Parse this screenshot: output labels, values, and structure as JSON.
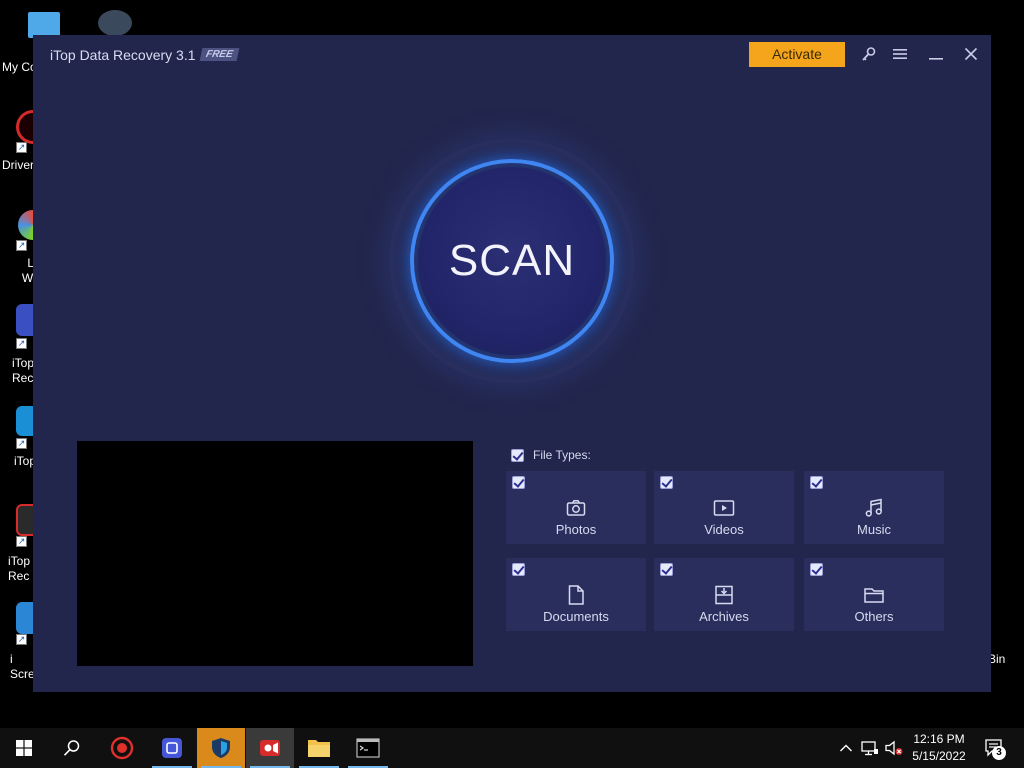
{
  "desktop": {
    "icons": [
      {
        "label": "My Co"
      },
      {
        "label": "Driver"
      },
      {
        "label": "Li\nWal"
      },
      {
        "label": "iTop\nRec"
      },
      {
        "label": "iTop"
      },
      {
        "label": "iTop\nRec"
      },
      {
        "label": "i\nScre"
      }
    ],
    "recycle_label": "Bin"
  },
  "app": {
    "title": "iTop Data Recovery 3.1",
    "badge": "FREE",
    "activate_label": "Activate",
    "scan_label": "SCAN",
    "file_types_label": "File Types:",
    "file_types": [
      {
        "name": "Photos",
        "checked": true,
        "icon": "camera-icon"
      },
      {
        "name": "Videos",
        "checked": true,
        "icon": "video-icon"
      },
      {
        "name": "Music",
        "checked": true,
        "icon": "music-icon"
      },
      {
        "name": "Documents",
        "checked": true,
        "icon": "document-icon"
      },
      {
        "name": "Archives",
        "checked": true,
        "icon": "archive-icon"
      },
      {
        "name": "Others",
        "checked": true,
        "icon": "folder-icon"
      }
    ],
    "colors": {
      "background": "#22264d",
      "accent": "#f4a51c",
      "scan_ring": "#3f86f3"
    }
  },
  "taskbar": {
    "time": "12:16 PM",
    "date": "5/15/2022",
    "notification_count": "3"
  }
}
